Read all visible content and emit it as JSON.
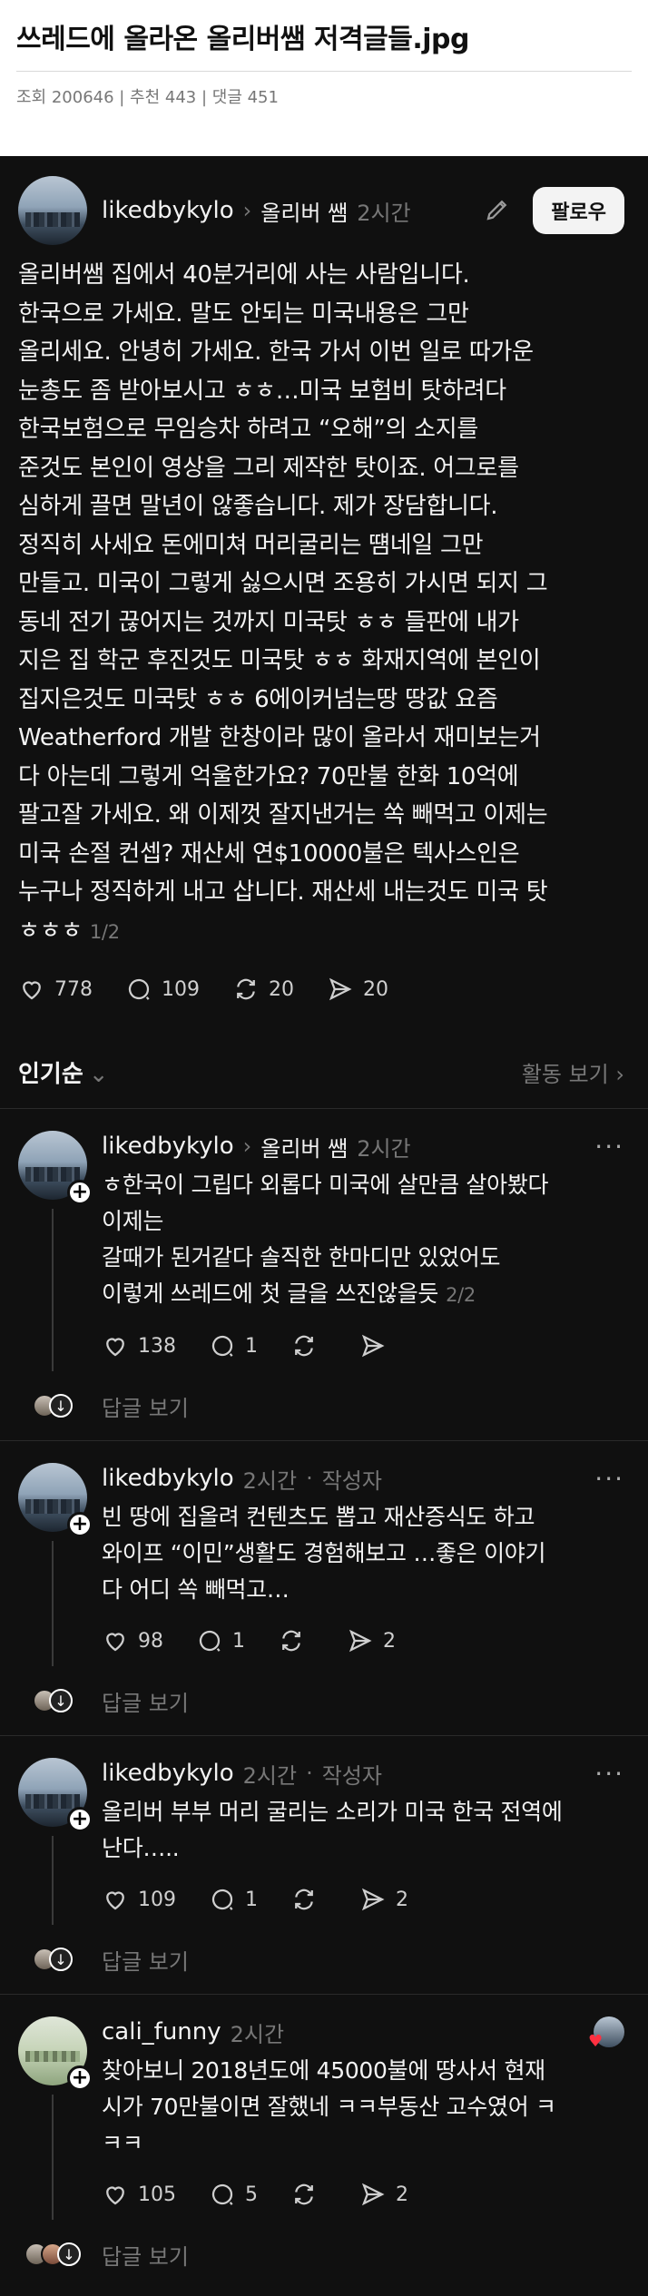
{
  "header": {
    "title": "쓰레드에 올라온 올리버쌤 저격글들.jpg",
    "meta": "조회 200646 | 추천 443 | 댓글 451"
  },
  "post": {
    "username": "likedbykylo",
    "reply_to": "올리버 쌤",
    "time": "2시간",
    "follow_label": "팔로우",
    "body": "올리버쌤 집에서 40분거리에 사는 사람입니다.\n한국으로 가세요. 말도 안되는 미국내용은 그만\n올리세요. 안녕히 가세요. 한국 가서 이번 일로 따가운\n눈총도 좀 받아보시고 ㅎㅎ…미국 보험비 탓하려다\n한국보험으로 무임승차 하려고 “오해”의 소지를\n준것도 본인이 영상을 그리 제작한 탓이죠. 어그로를\n심하게 끌면 말년이 않좋습니다. 제가 장담합니다.\n정직히 사세요 돈에미쳐 머리굴리는 떔네일 그만\n만들고. 미국이 그렇게 싫으시면 조용히 가시면 되지 그\n동네 전기 끊어지는 것까지 미국탓 ㅎㅎ 들판에 내가\n지은 집 학군 후진것도 미국탓 ㅎㅎ 화재지역에 본인이\n집지은것도 미국탓 ㅎㅎ 6에이커넘는땅 땅값 요즘\nWeatherford 개발 한창이라 많이 올라서 재미보는거\n다 아는데 그렇게 억울한가요? 70만불 한화 10억에\n팔고잘 가세요. 왜 이제껏 잘지낸거는 쏙 빼먹고 이제는\n미국 손절 컨셉?  재산세 연$10000불은 텍사스인은\n누구나 정직하게 내고 삽니다. 재산세 내는것도 미국 탓\nㅎㅎㅎ",
    "page": "1/2",
    "likes": "778",
    "comments": "109",
    "reposts": "20",
    "shares": "20"
  },
  "sort": {
    "label": "인기순",
    "activity": "활동 보기 ›"
  },
  "comments": [
    {
      "username": "likedbykylo",
      "reply_to": "올리버 쌤",
      "time": "2시간",
      "tag": "",
      "body": "ㅎ한국이 그립다 외롭다 미국에 살만큼 살아봤다\n이제는\n갈때가 된거같다 솔직한 한마디만 있었어도\n이렇게 쓰레드에 첫 글을 쓰진않을듯",
      "page": "2/2",
      "likes": "138",
      "comments": "1",
      "shares": "",
      "reply_label": "답글 보기"
    },
    {
      "username": "likedbykylo",
      "time": "2시간",
      "tag": "작성자",
      "body": "빈 땅에 집올려 컨텐츠도 뽑고 재산증식도 하고\n와이프 “이민”생활도 경험해보고 …좋은 이야기\n다 어디 쏙 빼먹고…",
      "likes": "98",
      "comments": "1",
      "shares": "2",
      "reply_label": "답글 보기"
    },
    {
      "username": "likedbykylo",
      "time": "2시간",
      "tag": "작성자",
      "body": "올리버 부부 머리 굴리는 소리가 미국 한국 전역에\n난다…..",
      "likes": "109",
      "comments": "1",
      "shares": "2",
      "reply_label": "답글 보기"
    },
    {
      "username": "cali_funny",
      "time": "2시간",
      "tag": "",
      "body": "찾아보니 2018년도에 45000불에 땅사서 현재\n시가 70만불이면 잘했네 ㅋㅋ부동산 고수였어 ㅋ\nㅋㅋ",
      "likes": "105",
      "comments": "5",
      "shares": "2",
      "reply_label": "답글 보기"
    }
  ],
  "colors": {
    "background": "#101010",
    "header_bg": "#ffffff",
    "muted_text": "#777777",
    "heart_red": "#ff3040"
  }
}
